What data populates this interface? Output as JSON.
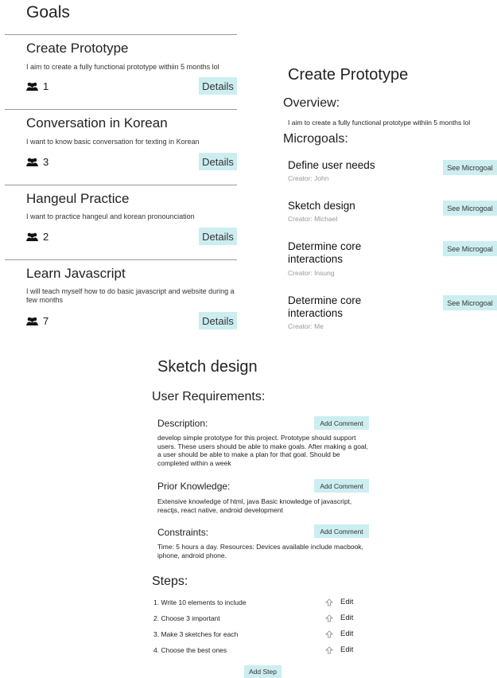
{
  "goals_list": {
    "title": "Goals",
    "items": [
      {
        "title": "Create Prototype",
        "description": "I aim to create a fully functional prototype withiin 5 months lol",
        "members": "1",
        "details_label": "Details"
      },
      {
        "title": "Conversation in Korean",
        "description": "I want to know basic conversation for texting in Korean",
        "members": "3",
        "details_label": "Details"
      },
      {
        "title": "Hangeul Practice",
        "description": "I want to practice hangeul and korean pronounciation",
        "members": "2",
        "details_label": "Details"
      },
      {
        "title": "Learn Javascript",
        "description": "I will teach myself how to do basic javascript and website during a few months",
        "members": "7",
        "details_label": "Details"
      }
    ]
  },
  "goal_detail": {
    "title": "Create Prototype",
    "overview_label": "Overview:",
    "overview_text": "I aim to create a fully functional prototype withiin 5 months lol",
    "microgoals_label": "Microgoals:",
    "microgoals": [
      {
        "title": "Define user needs",
        "creator": "Creator: John",
        "button": "See Microgoal"
      },
      {
        "title": "Sketch design",
        "creator": "Creator: Michael",
        "button": "See Microgoal"
      },
      {
        "title": "Determine core interactions",
        "creator": "Creator: Insung",
        "button": "See Microgoal"
      },
      {
        "title": "Determine core interactions",
        "creator": "Creator: Me",
        "button": "See Microgoal"
      }
    ]
  },
  "microgoal_detail": {
    "title": "Sketch design",
    "requirements_label": "User Requirements:",
    "sections": [
      {
        "label": "Description:",
        "text": "develop simple prototype for this project. Prototype should support users. These users should be able to make goals. After making a goal, a user should be able to make a plan for that goal. Should be completed within a week",
        "button": "Add Comment"
      },
      {
        "label": "Prior Knowledge:",
        "text": "Extensive knowledge of html, java Basic knowledge of javascript, reactjs, react native, android development",
        "button": "Add Comment"
      },
      {
        "label": "Constraints:",
        "text": "Time: 5 hours a day. Resources: Devices available include macbook, iphone, android phone.",
        "button": "Add Comment"
      }
    ],
    "steps_label": "Steps:",
    "steps": [
      {
        "text": "1. Write 10 elements to include",
        "edit": "Edit"
      },
      {
        "text": "2. Choose 3 important",
        "edit": "Edit"
      },
      {
        "text": "3. Make 3 sketches for each",
        "edit": "Edit"
      },
      {
        "text": "4. Choose the best ones",
        "edit": "Edit"
      }
    ],
    "add_step_label": "Add Step"
  },
  "icons": {
    "members": "group-icon",
    "step_move": "up-arrow-icon"
  },
  "colors": {
    "accent_button": "#cdeef1",
    "divider": "#9a9a9a",
    "muted_text": "#999999"
  }
}
